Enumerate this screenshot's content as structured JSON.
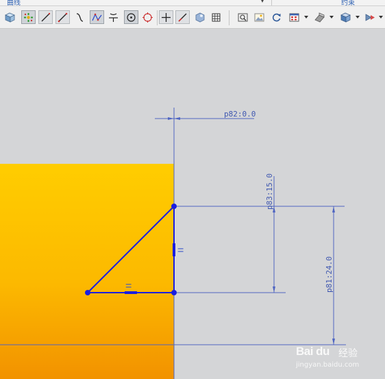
{
  "tabs": {
    "left_label": "曲线",
    "right_label": "约束"
  },
  "toolbar": {
    "buttons": [
      {
        "name": "view-cube-icon"
      },
      {
        "name": "constraint-inference-icon"
      },
      {
        "name": "profile-line-icon"
      },
      {
        "name": "line-icon"
      },
      {
        "name": "arc-icon"
      },
      {
        "name": "studio-spline-icon"
      },
      {
        "name": "fillet-icon"
      },
      {
        "name": "circle-icon"
      },
      {
        "name": "point-icon"
      },
      {
        "name": "cross-icon"
      },
      {
        "name": "quick-trim-icon"
      },
      {
        "name": "sketch-settings-icon"
      },
      {
        "name": "grid-icon"
      },
      {
        "name": "zoom-fit-icon"
      },
      {
        "name": "image-icon"
      },
      {
        "name": "refresh-icon"
      },
      {
        "name": "layout-icon"
      },
      {
        "name": "render-style-icon"
      },
      {
        "name": "shaded-cube-icon"
      },
      {
        "name": "display-mode-icon"
      }
    ]
  },
  "dimensions": {
    "d1": "p82:0.0",
    "d2": "p83:15.0",
    "d3": "p81:24.0"
  },
  "constraints": {
    "vertical_symbol": "=",
    "horizontal_symbol": "="
  },
  "colors": {
    "sketch_line": "#1a1ee0",
    "dimension": "#3f57b0",
    "face_top": "#ffcc00",
    "face_bottom": "#f29500",
    "background": "#d4d5d7"
  },
  "watermark": {
    "logo": "Bai du",
    "cn": "经验",
    "url": "jingyan.baidu.com"
  }
}
